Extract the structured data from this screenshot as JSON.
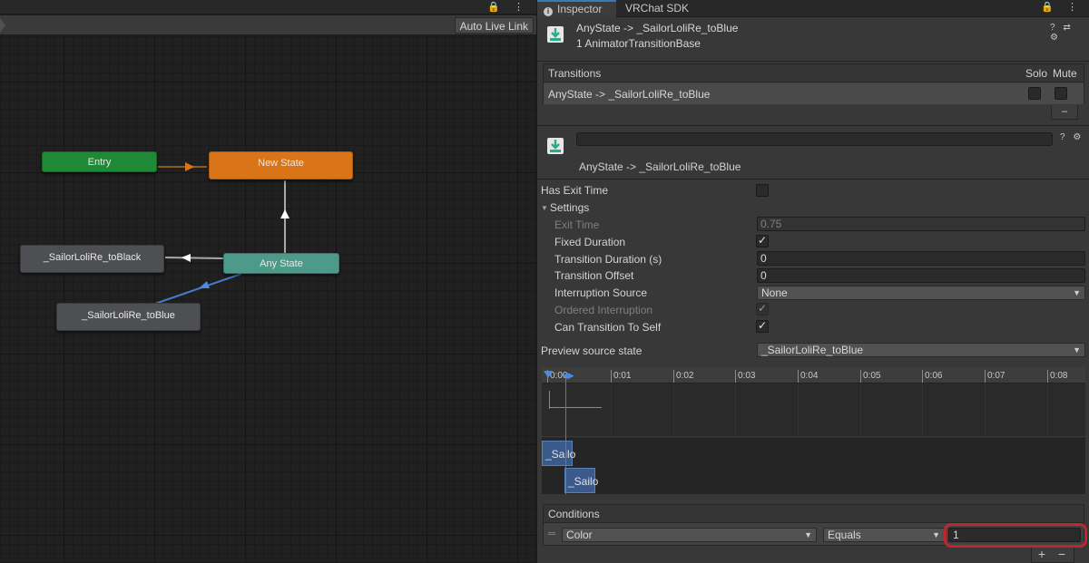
{
  "graph": {
    "auto_live_link": "Auto Live Link",
    "top_icons": "🔒 ⋮",
    "nodes": {
      "entry": "Entry",
      "new_state": "New State",
      "any_state": "Any State",
      "to_black": "_SailorLoliRe_toBlack",
      "to_blue": "_SailorLoliRe_toBlue"
    }
  },
  "inspector": {
    "tabs": {
      "inspector": "Inspector",
      "vrchat": "VRChat SDK"
    },
    "tab_icons": "🔒 ⋮",
    "header": {
      "title": "AnyState -> _SailorLoliRe_toBlue",
      "subtitle": "1 AnimatorTransitionBase",
      "tools": "? ⇄ ⚙"
    },
    "transitions": {
      "heading": "Transitions",
      "solo": "Solo",
      "mute": "Mute",
      "row_label": "AnyState -> _SailorLoliRe_toBlue",
      "remove": "−"
    },
    "transition_detail": {
      "title": "AnyState -> _SailorLoliRe_toBlue",
      "tools": "? ⚙",
      "has_exit_time_label": "Has Exit Time",
      "settings_label": "Settings",
      "exit_time_label": "Exit Time",
      "exit_time_value": "0.75",
      "fixed_duration_label": "Fixed Duration",
      "transition_duration_label": "Transition Duration (s)",
      "transition_duration_value": "0",
      "transition_offset_label": "Transition Offset",
      "transition_offset_value": "0",
      "interruption_source_label": "Interruption Source",
      "interruption_source_value": "None",
      "ordered_interruption_label": "Ordered Interruption",
      "can_transition_to_self_label": "Can Transition To Self",
      "preview_source_label": "Preview source state",
      "preview_source_value": "_SailorLoliRe_toBlue"
    },
    "timeline": {
      "ticks": [
        "0:00",
        "0:01",
        "0:02",
        "0:03",
        "0:04",
        "0:05",
        "0:06",
        "0:07",
        "0:08"
      ],
      "clip_source": "_Sailo",
      "clip_dest": "_Sailo"
    },
    "conditions": {
      "heading": "Conditions",
      "parameter": "Color",
      "mode": "Equals",
      "value": "1",
      "add": "+",
      "remove": "−"
    },
    "colors": {
      "entry": "#1e8a36",
      "new_state": "#d97518",
      "any_state": "#4e9a8a",
      "highlight": "#c0262d",
      "accent": "#3a79bb"
    }
  }
}
